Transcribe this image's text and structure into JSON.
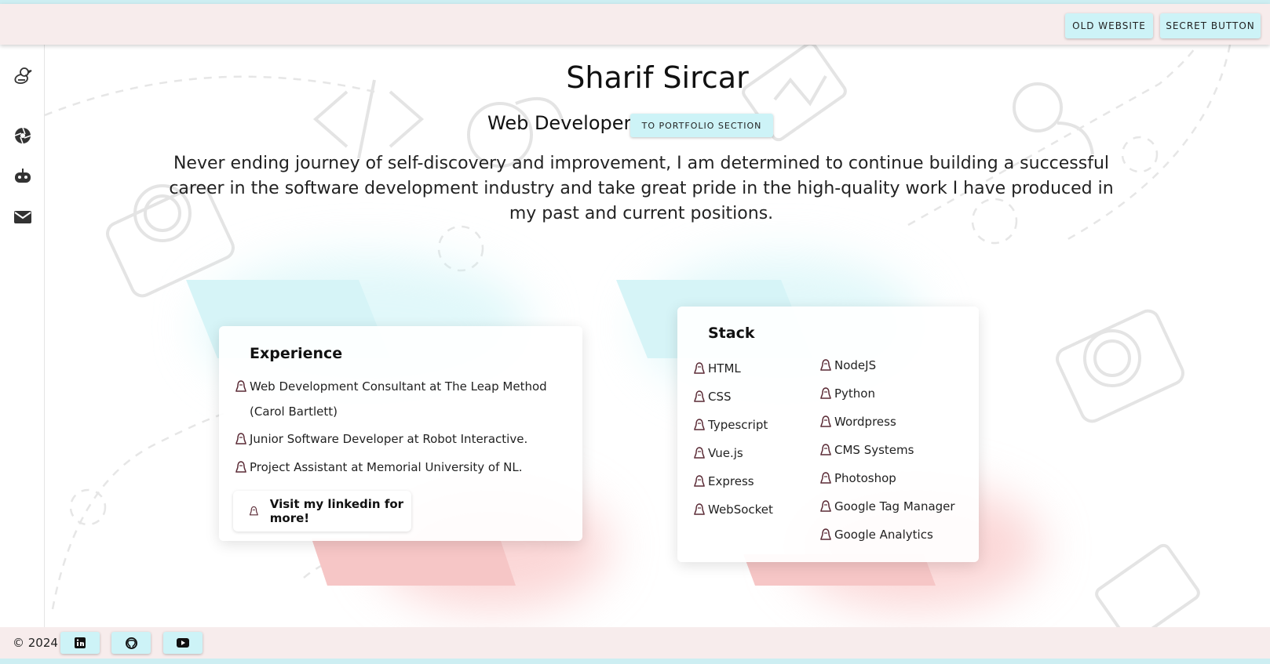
{
  "header": {
    "old_website_label": "OLD WEBSITE",
    "secret_button_label": "SECRET BUTTON"
  },
  "sidebar": {
    "items": [
      {
        "icon": "duck-icon"
      },
      {
        "icon": "aperture-icon"
      },
      {
        "icon": "robot-icon"
      },
      {
        "icon": "mail-icon"
      }
    ]
  },
  "hero": {
    "name": "Sharif Sircar",
    "role": "Web Developer",
    "portfolio_button": "TO PORTFOLIO SECTION",
    "intro": "Never ending journey of self-discovery and improvement, I am determined to continue building a successful career in the software development industry and take great pride in the high-quality work I have produced in my past and current positions."
  },
  "experience": {
    "title": "Experience",
    "items": [
      "Web Development Consultant at The Leap Method (Carol Bartlett)",
      "Junior Software Developer at Robot Interactive.",
      "Project Assistant at Memorial University of NL."
    ],
    "linkedin_button": "Visit my linkedin for more!"
  },
  "stack": {
    "title": "Stack",
    "column_1": [
      "HTML",
      "CSS",
      "Typescript",
      "Vue.js",
      "Express",
      "WebSocket"
    ],
    "column_2": [
      "NodeJS",
      "Python",
      "Wordpress",
      "CMS Systems",
      "Photoshop",
      "Google Tag Manager",
      "Google Analytics"
    ]
  },
  "footer": {
    "copyright": "© 2024",
    "links": [
      {
        "icon": "linkedin-icon"
      },
      {
        "icon": "github-icon"
      },
      {
        "icon": "youtube-icon"
      }
    ]
  },
  "colors": {
    "accent": "#cdf3f7",
    "header_bg": "#f7ecec",
    "pink_glow": "#f8b6b6",
    "teal_glow": "#c9f2f6"
  }
}
